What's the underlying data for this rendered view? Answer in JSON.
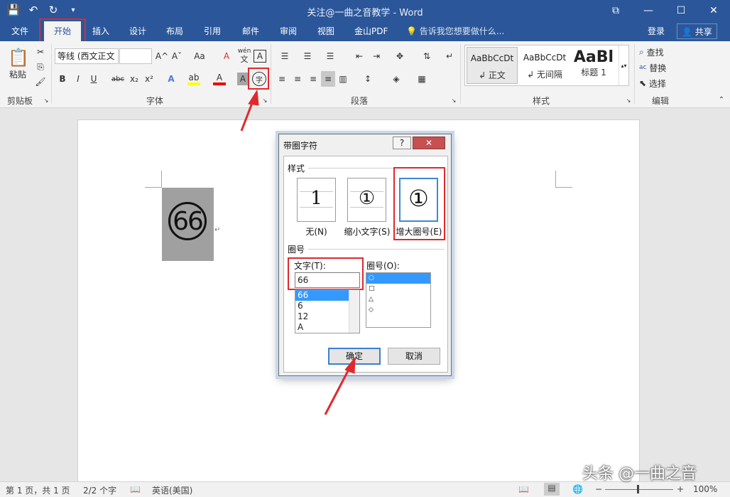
{
  "titlebar": {
    "title": "关注@一曲之音教学 - Word",
    "save_icon": "save-icon",
    "undo_icon": "undo-icon",
    "redo_icon": "redo-icon",
    "customize": "▾",
    "restore": "⧉",
    "minimize": "—",
    "maximize": "☐",
    "close": "✕"
  },
  "tabs": [
    "文件",
    "开始",
    "插入",
    "设计",
    "布局",
    "引用",
    "邮件",
    "审阅",
    "视图",
    "金山PDF"
  ],
  "tellme": "告诉我您想要做什么...",
  "login": "登录",
  "share": "共享",
  "ribbon": {
    "clipboard": {
      "paste": "粘贴",
      "group": "剪贴板"
    },
    "font": {
      "name": "等线 (西文正文",
      "size": "",
      "group": "字体",
      "bold": "B",
      "italic": "I",
      "underline": "U",
      "strike": "abc",
      "sub": "x₂",
      "sup": "x²",
      "grow": "A^",
      "shrink": "Aˇ",
      "case": "Aa",
      "phonetic_top": "wén",
      "phonetic_bottom": "文",
      "border_char": "A",
      "enclose": "字"
    },
    "paragraph": {
      "group": "段落"
    },
    "styles": {
      "group": "样式",
      "items": [
        {
          "preview": "AaBbCcDt",
          "name": "↲ 正文"
        },
        {
          "preview": "AaBbCcDt",
          "name": "↲ 无间隔"
        },
        {
          "preview": "AaBl",
          "name": "标题 1"
        }
      ]
    },
    "editing": {
      "group": "编辑",
      "find": "查找",
      "replace": "替换",
      "select": "选择"
    }
  },
  "document": {
    "enclosed_text": "66",
    "para_mark": "↵"
  },
  "dialog": {
    "title": "带圈字符",
    "help": "?",
    "close": "✕",
    "style_section": "样式",
    "styles": [
      {
        "glyph": "1",
        "caption": "无(N)"
      },
      {
        "glyph": "①",
        "caption": "缩小文字(S)"
      },
      {
        "glyph": "①",
        "caption": "增大圈号(E)"
      }
    ],
    "circle_section": "圈号",
    "text_label": "文字(T):",
    "text_value": "66",
    "text_list": [
      "66",
      "6",
      "12",
      "A"
    ],
    "shape_label": "圈号(O):",
    "shape_list": [
      "○",
      "□",
      "△",
      "◇"
    ],
    "ok": "确定",
    "cancel": "取消"
  },
  "status": {
    "page": "第 1 页，共 1 页",
    "words": "2/2 个字",
    "lang": "英语(美国)",
    "zoom": "100%",
    "zoom_minus": "−",
    "zoom_plus": "+"
  },
  "watermark": "头条 @一曲之音",
  "colors": {
    "accent": "#2b579a",
    "highlight_red": "#e0292d",
    "selection_blue": "#3399ff"
  }
}
